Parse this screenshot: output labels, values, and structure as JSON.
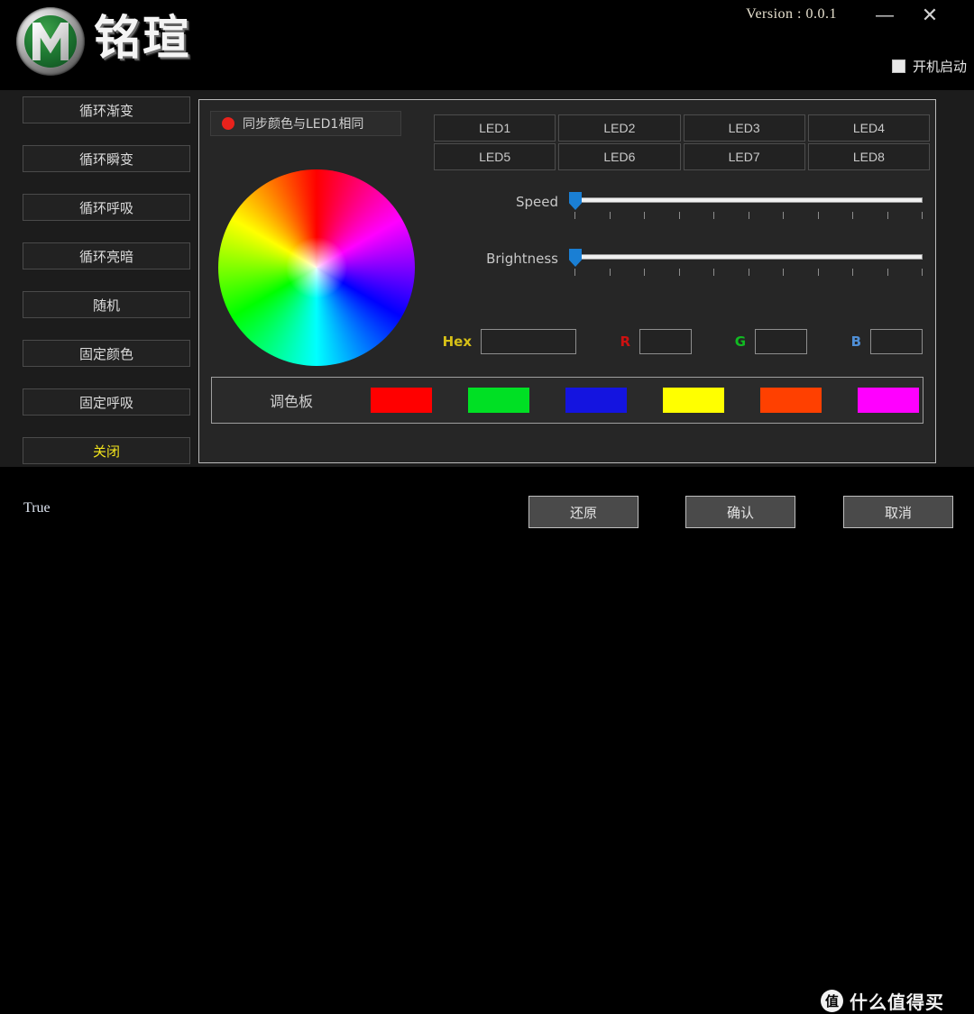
{
  "window": {
    "brand_name": "铭瑄",
    "version_label": "Version : 0.0.1",
    "minimize_icon": "minimize-icon",
    "close_icon": "close-icon",
    "minimize_glyph": "―",
    "close_glyph": "✕",
    "startup_label": "开机启动",
    "startup_checked": true
  },
  "sidebar": {
    "items": [
      {
        "label": "循环渐变",
        "active": false
      },
      {
        "label": "循环瞬变",
        "active": false
      },
      {
        "label": "循环呼吸",
        "active": false
      },
      {
        "label": "循环亮暗",
        "active": false
      },
      {
        "label": "随机",
        "active": false
      },
      {
        "label": "固定颜色",
        "active": false
      },
      {
        "label": "固定呼吸",
        "active": false
      },
      {
        "label": "关闭",
        "active": true
      }
    ]
  },
  "main": {
    "sync": {
      "label": "同步颜色与LED1相同",
      "radio_color": "#e8221c",
      "selected": true
    },
    "color_wheel": {
      "icon": "color-wheel",
      "hues": [
        "#ff0000",
        "#ff00ff",
        "#0000ff",
        "#00ffff",
        "#00ff00",
        "#ffff00"
      ]
    },
    "leds": [
      "LED1",
      "LED2",
      "LED3",
      "LED4",
      "LED5",
      "LED6",
      "LED7",
      "LED8"
    ],
    "sliders": [
      {
        "label": "Speed",
        "value": 0,
        "min": 0,
        "max": 100,
        "ticks": 11,
        "thumb_color": "#1a7fd4"
      },
      {
        "label": "Brightness",
        "value": 0,
        "min": 0,
        "max": 100,
        "ticks": 11,
        "thumb_color": "#1a7fd4"
      }
    ],
    "color_fields": {
      "hex": {
        "label": "Hex",
        "value": "",
        "placeholder": "",
        "label_color": "#d6c017"
      },
      "r": {
        "label": "R",
        "value": "",
        "placeholder": "",
        "label_color": "#cc1111"
      },
      "g": {
        "label": "G",
        "value": "",
        "placeholder": "",
        "label_color": "#11bb22"
      },
      "b": {
        "label": "B",
        "value": "",
        "placeholder": "",
        "label_color": "#4f8fd6"
      }
    },
    "palette": {
      "title": "调色板",
      "swatches": [
        "#ff0000",
        "#00e024",
        "#1414e0",
        "#ffff00",
        "#ff4000",
        "#ff00ff"
      ]
    }
  },
  "footer": {
    "status_text": "True",
    "buttons": [
      {
        "label": "还原"
      },
      {
        "label": "确认"
      },
      {
        "label": "取消"
      }
    ],
    "watermark": {
      "mark": "值",
      "text": "什么值得买"
    }
  }
}
